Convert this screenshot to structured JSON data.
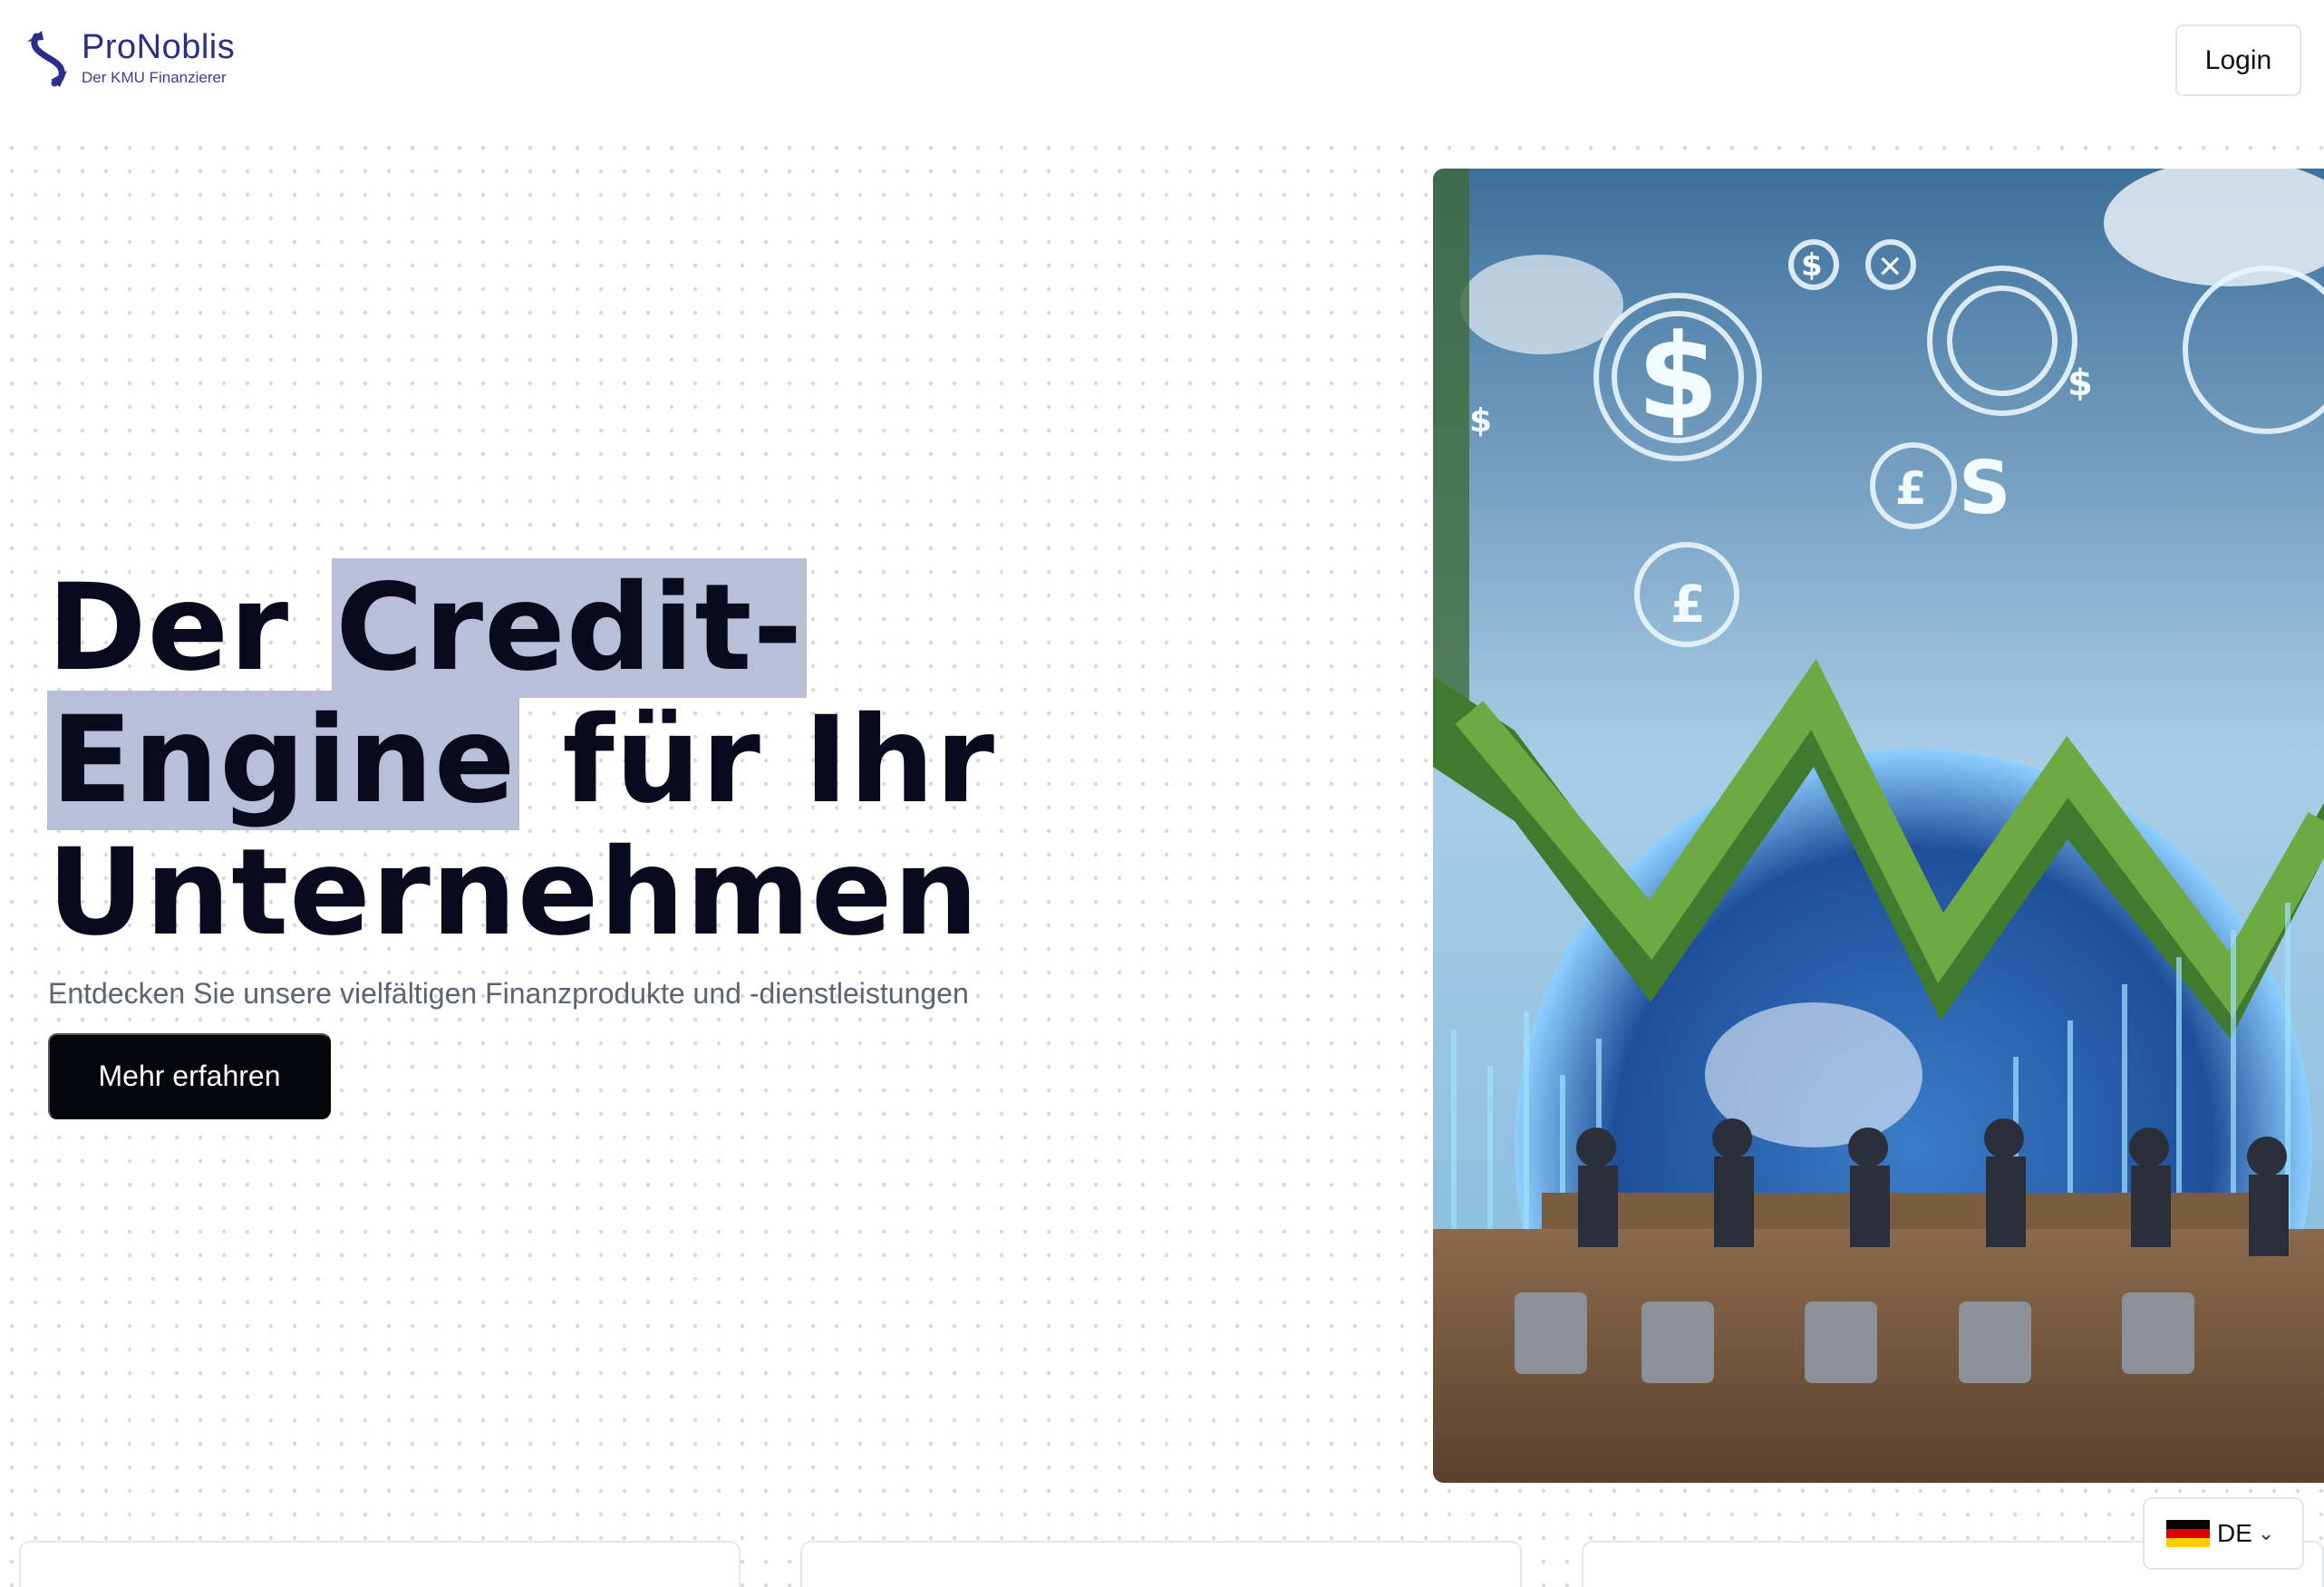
{
  "header": {
    "brand_name": "ProNoblis",
    "brand_tagline": "Der KMU Finanzierer",
    "login_label": "Login"
  },
  "hero": {
    "title_word1": "Der",
    "title_hl1": "Credit-",
    "title_hl2": "Engine",
    "title_rest": "für Ihr",
    "title_line3": "Unternehmen",
    "subtitle": "Entdecken Sie unsere vielfältigen Finanzprodukte und -dienstleistungen",
    "cta_label": "Mehr erfahren"
  },
  "language": {
    "selected": "DE"
  },
  "colors": {
    "brand": "#2b2f8c",
    "highlight": "#b9bfd8",
    "cta_bg": "#05050c"
  }
}
